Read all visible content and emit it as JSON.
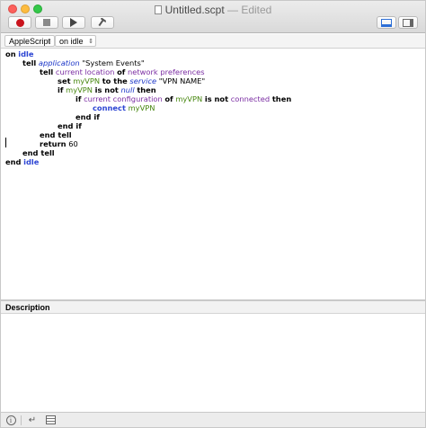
{
  "window": {
    "title": "Untitled.scpt",
    "title_suffix": "— Edited"
  },
  "toolbar": {
    "record_icon": "record-icon",
    "stop_icon": "stop-icon",
    "run_icon": "run-icon",
    "compile_icon": "hammer-icon"
  },
  "navbar": {
    "language": "AppleScript",
    "handler": "on idle"
  },
  "code": {
    "l1": [
      "on",
      "idle"
    ],
    "l2": [
      "tell",
      "application",
      "\"System Events\""
    ],
    "l3": [
      "tell",
      "current location",
      "of",
      "network preferences"
    ],
    "l4": [
      "set",
      "myVPN",
      "to the",
      "service",
      "\"VPN NAME\""
    ],
    "l5": [
      "if",
      "myVPN",
      "is not",
      "null",
      "then"
    ],
    "l6": [
      "if",
      "current configuration",
      "of",
      "myVPN",
      "is not",
      "connected",
      "then"
    ],
    "l7": [
      "connect",
      "myVPN"
    ],
    "l8": "end if",
    "l9": "end if",
    "l10": "end tell",
    "l11": [
      "return",
      "60"
    ],
    "l12": "end tell",
    "l13": [
      "end",
      "idle"
    ]
  },
  "description": {
    "label": "Description",
    "text": ""
  },
  "colors": {
    "keyword": "#000000",
    "application_keyword": "#1c36c8",
    "property": "#7a2ca2",
    "variable": "#46860e",
    "record_button": "#c9131c"
  }
}
